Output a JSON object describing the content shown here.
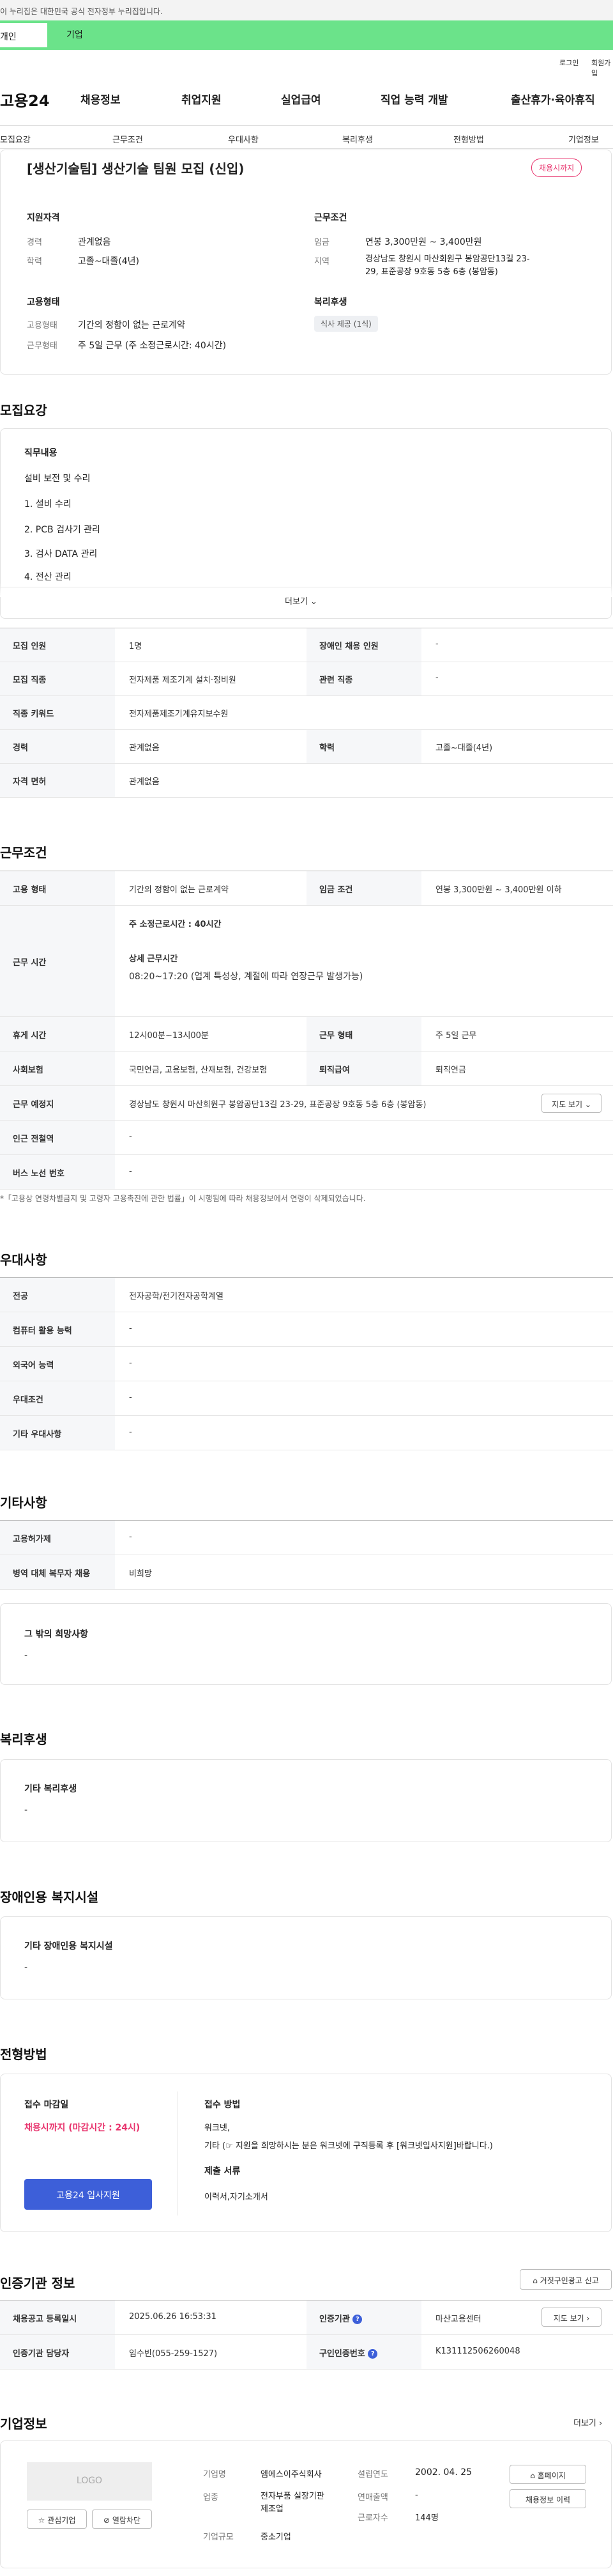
{
  "top": {
    "gov_notice": "이 누리집은 대한민국 공식 전자정부 누리집입니다.",
    "tab_person": "개인",
    "tab_company": "기업",
    "login": "로그인",
    "join": "회원가입"
  },
  "gnb": {
    "logo": "고용24",
    "items": [
      "채용정보",
      "취업지원",
      "실업급여",
      "직업 능력 개발",
      "출산휴가·육아휴직"
    ]
  },
  "subnav": [
    "모집요강",
    "근무조건",
    "우대사항",
    "복리후생",
    "전형방법",
    "기업정보"
  ],
  "summary": {
    "title": "[생산기술팀] 생산기술 팀원 모집 (신입)",
    "badge": "채용시까지",
    "qual_title": "지원자격",
    "cond_title": "근무조건",
    "career_label": "경력",
    "career_value": "관계없음",
    "edu_label": "학력",
    "edu_value": "고졸~대졸(4년)",
    "wage_label": "임금",
    "wage_value": "연봉 3,300만원 ~ 3,400만원",
    "area_label": "지역",
    "area_value": "경상남도 창원시 마산회원구 봉암공단13길 23-29, 표준공장 9호동 5층 6층 (봉암동)",
    "emp_title": "고용형태",
    "emp_label": "고용형태",
    "emp_value": "기간의 정함이 없는 근로계약",
    "worktype_label": "근무형태",
    "worktype_value": "주 5일 근무 (주 소정근로시간: 40시간)",
    "welfare_title": "복리후생",
    "welfare_chip": "식사 제공 (1식)"
  },
  "recruit": {
    "section_title": "모집요강",
    "duty_title": "직무내용",
    "duty_lines": [
      "설비 보전 및 수리",
      "1. 설비 수리",
      "2. PCB 검사기 관리",
      "3. 검사 DATA 관리",
      "4. 전산 관리"
    ],
    "more": "더보기",
    "table": [
      [
        "모집 인원",
        "1명",
        "장애인 채용 인원",
        "-"
      ],
      [
        "모집 직종",
        "전자제품 제조기계 설치·정비원",
        "관련 직종",
        "-"
      ],
      [
        "직종 키워드",
        "전자제품제조기계유지보수원",
        null,
        null
      ],
      [
        "경력",
        "관계없음",
        "학력",
        "고졸~대졸(4년)"
      ],
      [
        "자격 면허",
        "관계없음",
        null,
        null
      ]
    ]
  },
  "conditions": {
    "section_title": "근무조건",
    "emp_type_label": "고용 형태",
    "emp_type_value": "기간의 정함이 없는 근로계약",
    "wage_label": "임금 조건",
    "wage_value": "연봉 3,300만원 ~ 3,400만원 이하",
    "hours_label": "근무 시간",
    "hours_weekly": "주 소정근로시간 : 40시간",
    "hours_detail_title": "상세 근무시간",
    "hours_detail_value": "08:20~17:20 (업계 특성상, 계절에 따라 연장근무 발생가능)",
    "rest_label": "휴게 시간",
    "rest_value": "12시00분~13시00분",
    "worktype_label": "근무 형태",
    "worktype_value": "주 5일 근무",
    "insurance_label": "사회보험",
    "insurance_value": "국민연금, 고용보험, 산재보험, 건강보험",
    "severance_label": "퇴직급여",
    "severance_value": "퇴직연금",
    "place_label": "근무 예정지",
    "place_value": "경상남도 창원시 마산회원구 봉암공단13길 23-29, 표준공장 9호동 5층 6층 (봉암동)",
    "map_button": "지도 보기",
    "subway_label": "인근 전철역",
    "subway_value": "-",
    "bus_label": "버스 노선 번호",
    "bus_value": "-",
    "note": "*「고용상 연령차별금지 및 고령자 고용촉진에 관한 법률」이 시행됨에 따라 채용정보에서 연령이 삭제되었습니다."
  },
  "preference": {
    "section_title": "우대사항",
    "rows": [
      [
        "전공",
        "전자공학/전기전자공학계열"
      ],
      [
        "컴퓨터 활용 능력",
        "-"
      ],
      [
        "외국어 능력",
        "-"
      ],
      [
        "우대조건",
        "-"
      ],
      [
        "기타 우대사항",
        "-"
      ]
    ]
  },
  "etc": {
    "section_title": "기타사항",
    "rows": [
      [
        "고용허가제",
        "-"
      ],
      [
        "병역 대체 복무자 채용",
        "비희망"
      ]
    ],
    "hope_title": "그 밖의 희망사항",
    "hope_value": "-"
  },
  "welfare": {
    "section_title": "복리후생",
    "box_title": "기타 복리후생",
    "box_value": "-"
  },
  "disabled": {
    "section_title": "장애인용 복지시설",
    "box_title": "기타 장애인용 복지시설",
    "box_value": "-"
  },
  "process": {
    "section_title": "전형방법",
    "deadline_title": "접수 마감일",
    "deadline_value": "채용시까지 (마감시간 : 24시)",
    "apply_button": "고용24 입사지원",
    "method_title": "접수 방법",
    "method_line1": "워크넷,",
    "method_line2": "기타 (☞ 지원을 희망하시는 분은 워크넷에 구직등록 후 [워크넷입사지원]바랍니다.)",
    "docs_title": "제출 서류",
    "docs_value": "이력서,자기소개서"
  },
  "cert": {
    "section_title": "인증기관 정보",
    "report_button": "거짓구인광고 신고",
    "rows": [
      [
        "채용공고 등록일시",
        "2025.06.26 16:53:31",
        "인증기관",
        "마산고용센터"
      ],
      [
        "인증기관 담당자",
        "임수빈(055-259-1527)",
        "구인인증번호",
        "K131112506260048"
      ]
    ],
    "map_button": "지도 보기"
  },
  "company": {
    "section_title": "기업정보",
    "more": "더보기",
    "logo_text": "LOGO",
    "fav_button": "관심기업",
    "block_button": "열람차단",
    "name_label": "기업명",
    "name_value": "엠에스이주식회사",
    "founded_label": "설립연도",
    "founded_value": "2002. 04. 25",
    "industry_label": "업종",
    "industry_value": "전자부품 실장기판 제조업",
    "sales_label": "연매출액",
    "sales_value": "-",
    "scale_label": "기업규모",
    "scale_value": "중소기업",
    "workers_label": "근로자수",
    "workers_value": "144명",
    "home_button": "홈페이지",
    "jobs_button": "채용정보 이력"
  }
}
